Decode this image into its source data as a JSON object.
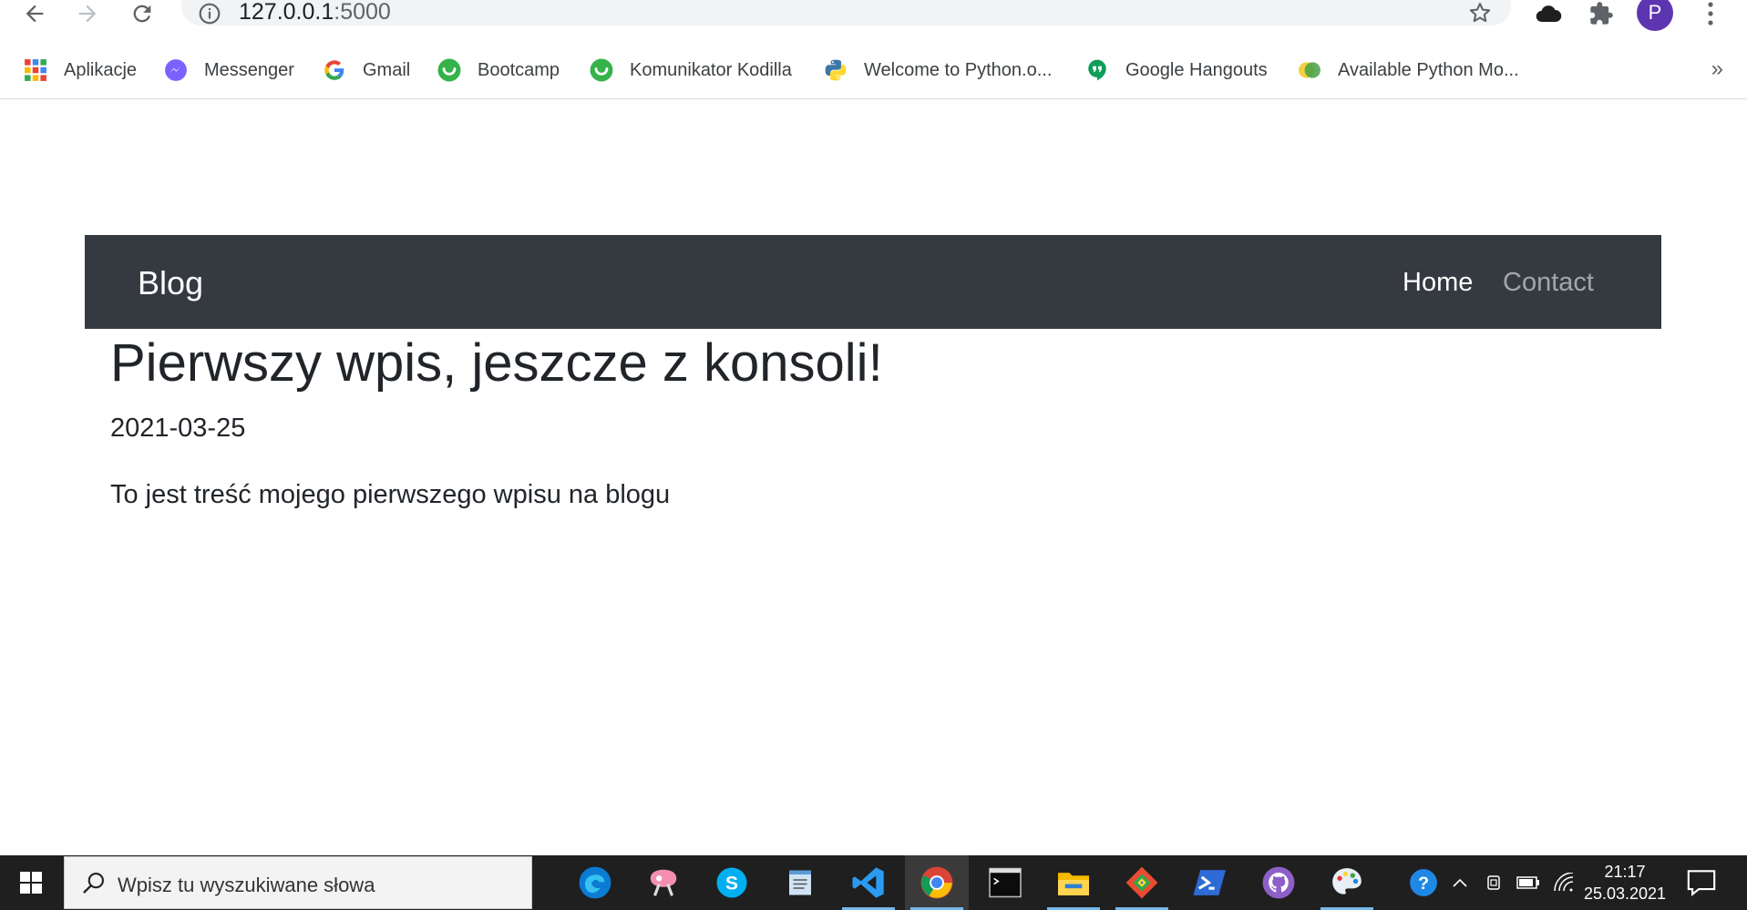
{
  "browser": {
    "url_host": "127.0.0.1",
    "url_port": ":5000",
    "profile_initial": "P",
    "bookmarks": [
      {
        "label": "Aplikacje",
        "icon": "apps-grid-icon"
      },
      {
        "label": "Messenger",
        "icon": "messenger-icon"
      },
      {
        "label": "Gmail",
        "icon": "google-g-icon"
      },
      {
        "label": "Bootcamp",
        "icon": "kodilla-icon"
      },
      {
        "label": "Komunikator Kodilla",
        "icon": "kodilla-icon"
      },
      {
        "label": "Welcome to Python.o...",
        "icon": "python-icon"
      },
      {
        "label": "Google Hangouts",
        "icon": "hangouts-icon"
      },
      {
        "label": "Available Python Mo...",
        "icon": "python-modules-icon"
      }
    ],
    "bookmarks_more": "»"
  },
  "navbar": {
    "brand": "Blog",
    "links": [
      "Home",
      "Contact"
    ]
  },
  "post": {
    "title": "Pierwszy wpis, jeszcze z konsoli!",
    "date": "2021-03-25",
    "body": "To jest treść mojego pierwszego wpisu na blogu"
  },
  "taskbar": {
    "search_placeholder": "Wpisz tu wyszukiwane słowa",
    "time": "21:17",
    "date": "25.03.2021",
    "apps": [
      "edge-icon",
      "snip-sketch-icon",
      "skype-icon",
      "notepad-icon",
      "vscode-icon",
      "chrome-icon",
      "terminal-icon",
      "file-explorer-icon",
      "git-icon",
      "powershell-icon",
      "github-desktop-icon",
      "paint-icon"
    ]
  },
  "colors": {
    "navbar_bg": "#343a40",
    "profile_bg": "#5e35b1",
    "taskbar_bg": "#1f1f1f"
  }
}
